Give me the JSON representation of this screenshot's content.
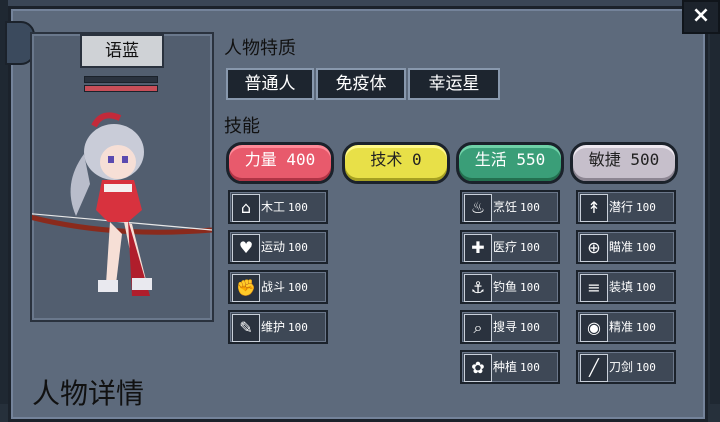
{
  "character": {
    "name": "语蓝",
    "traits_title": "人物特质",
    "traits": [
      "普通人",
      "免疫体",
      "幸运星"
    ],
    "skills_title": "技能",
    "detail_title": "人物详情"
  },
  "attributes": [
    {
      "label": "力量 400",
      "color": "#e85a6c"
    },
    {
      "label": "技术 0",
      "color": "#e8e048"
    },
    {
      "label": "生活 550",
      "color": "#3a9e78"
    },
    {
      "label": "敏捷 500",
      "color": "#c6bfcb"
    }
  ],
  "skills": {
    "col1": [
      {
        "name": "木工",
        "level": "100",
        "icon": "house-icon",
        "glyph": "⌂"
      },
      {
        "name": "运动",
        "level": "100",
        "icon": "heart-icon",
        "glyph": "♥"
      },
      {
        "name": "战斗",
        "level": "100",
        "icon": "fist-icon",
        "glyph": "✊"
      },
      {
        "name": "维护",
        "level": "100",
        "icon": "wrench-icon",
        "glyph": "✎"
      }
    ],
    "col3": [
      {
        "name": "烹饪",
        "level": "100",
        "icon": "cooking-pot-icon",
        "glyph": "♨"
      },
      {
        "name": "医疗",
        "level": "100",
        "icon": "medical-kit-icon",
        "glyph": "✚"
      },
      {
        "name": "钓鱼",
        "level": "100",
        "icon": "fish-hook-icon",
        "glyph": "⚓"
      },
      {
        "name": "搜寻",
        "level": "100",
        "icon": "magnifier-icon",
        "glyph": "⌕"
      },
      {
        "name": "种植",
        "level": "100",
        "icon": "plant-icon",
        "glyph": "✿"
      }
    ],
    "col4": [
      {
        "name": "潜行",
        "level": "100",
        "icon": "sneak-icon",
        "glyph": "↟"
      },
      {
        "name": "瞄准",
        "level": "100",
        "icon": "crosshair-icon",
        "glyph": "⊕"
      },
      {
        "name": "装填",
        "level": "100",
        "icon": "ammo-icon",
        "glyph": "≡"
      },
      {
        "name": "精准",
        "level": "100",
        "icon": "eye-icon",
        "glyph": "◉"
      },
      {
        "name": "刀剑",
        "level": "100",
        "icon": "blade-icon",
        "glyph": "╱"
      }
    ]
  },
  "ui": {
    "close": "×"
  }
}
